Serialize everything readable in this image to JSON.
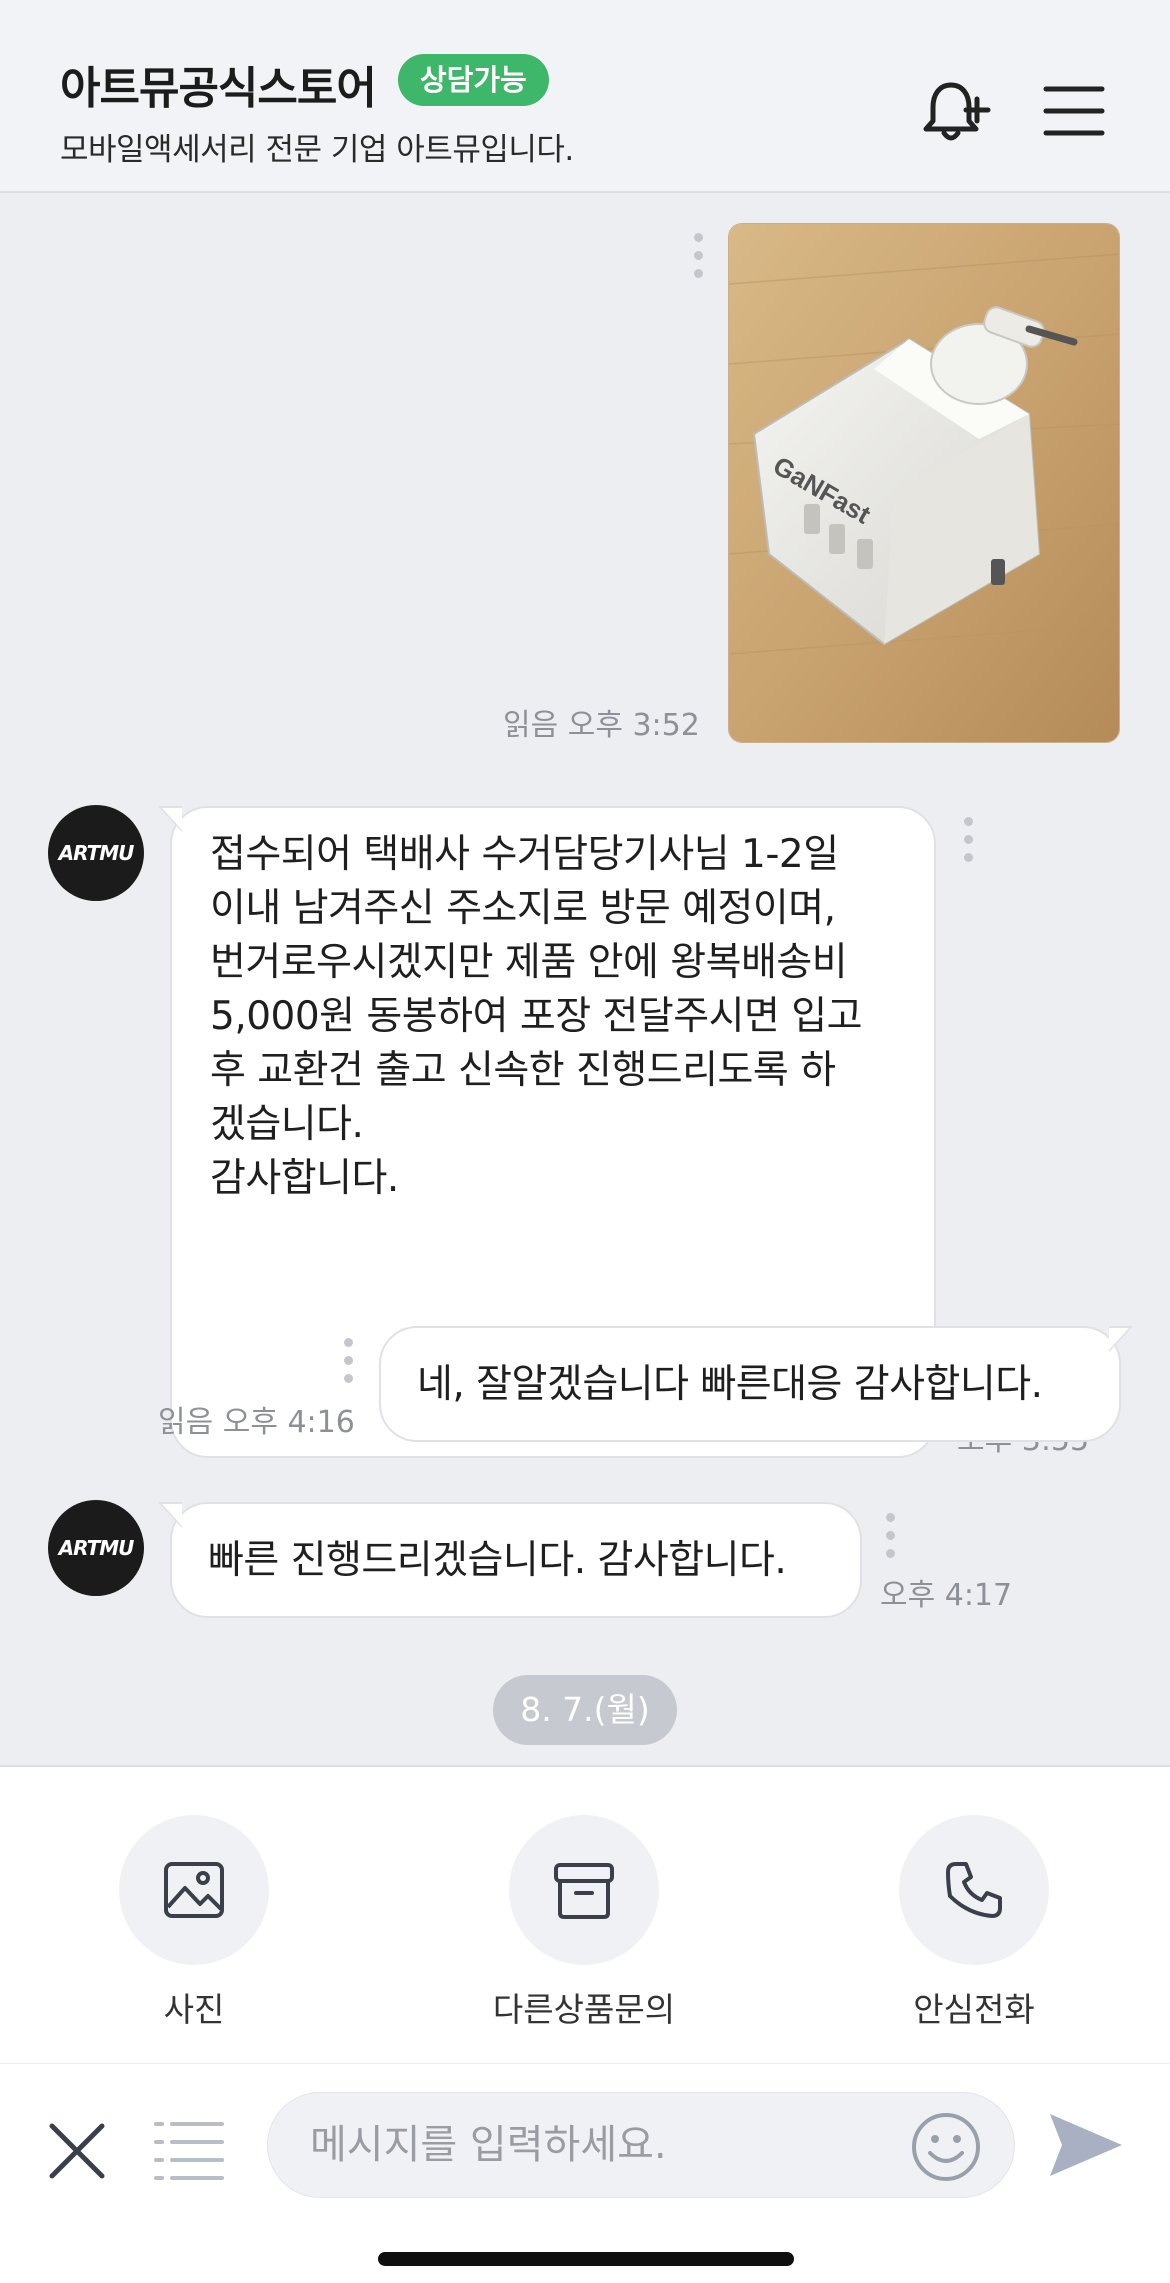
{
  "header": {
    "store_name": "아트뮤공식스토어",
    "status_badge": "상담가능",
    "description": "모바일액세서리 전문 기업 아트뮤입니다."
  },
  "messages": [
    {
      "type": "image",
      "direction": "out",
      "image_text": "GaNFast",
      "meta": "읽음 오후 3:52"
    },
    {
      "type": "text",
      "direction": "in",
      "avatar_text": "ARTMU",
      "lines": [
        "접수되어 택배사 수거담당기사님 1-2일",
        "이내 남겨주신 주소지로 방문 예정이며,",
        "번거로우시겠지만 제품 안에 왕복배송비",
        "5,000원 동봉하여 포장 전달주시면 입고",
        "후 교환건 출고 신속한 진행드리도록 하",
        "겠습니다.",
        "감사합니다."
      ],
      "meta": "오후 3:55"
    },
    {
      "type": "text",
      "direction": "out",
      "lines": [
        "네, 잘알겠습니다 빠른대응 감사합니다."
      ],
      "meta": "읽음 오후 4:16"
    },
    {
      "type": "text",
      "direction": "in",
      "avatar_text": "ARTMU",
      "lines": [
        "빠른 진행드리겠습니다. 감사합니다."
      ],
      "meta": "오후 4:17"
    }
  ],
  "date_chip": "8. 7.(월)",
  "actions": [
    {
      "label": "사진",
      "icon": "image-icon"
    },
    {
      "label": "다른상품문의",
      "icon": "box-icon"
    },
    {
      "label": "안심전화",
      "icon": "phone-icon"
    }
  ],
  "input": {
    "placeholder": "메시지를 입력하세요."
  },
  "colors": {
    "status": "#3fb76a",
    "send": "#a9b0c4",
    "background": "#edeef2"
  }
}
